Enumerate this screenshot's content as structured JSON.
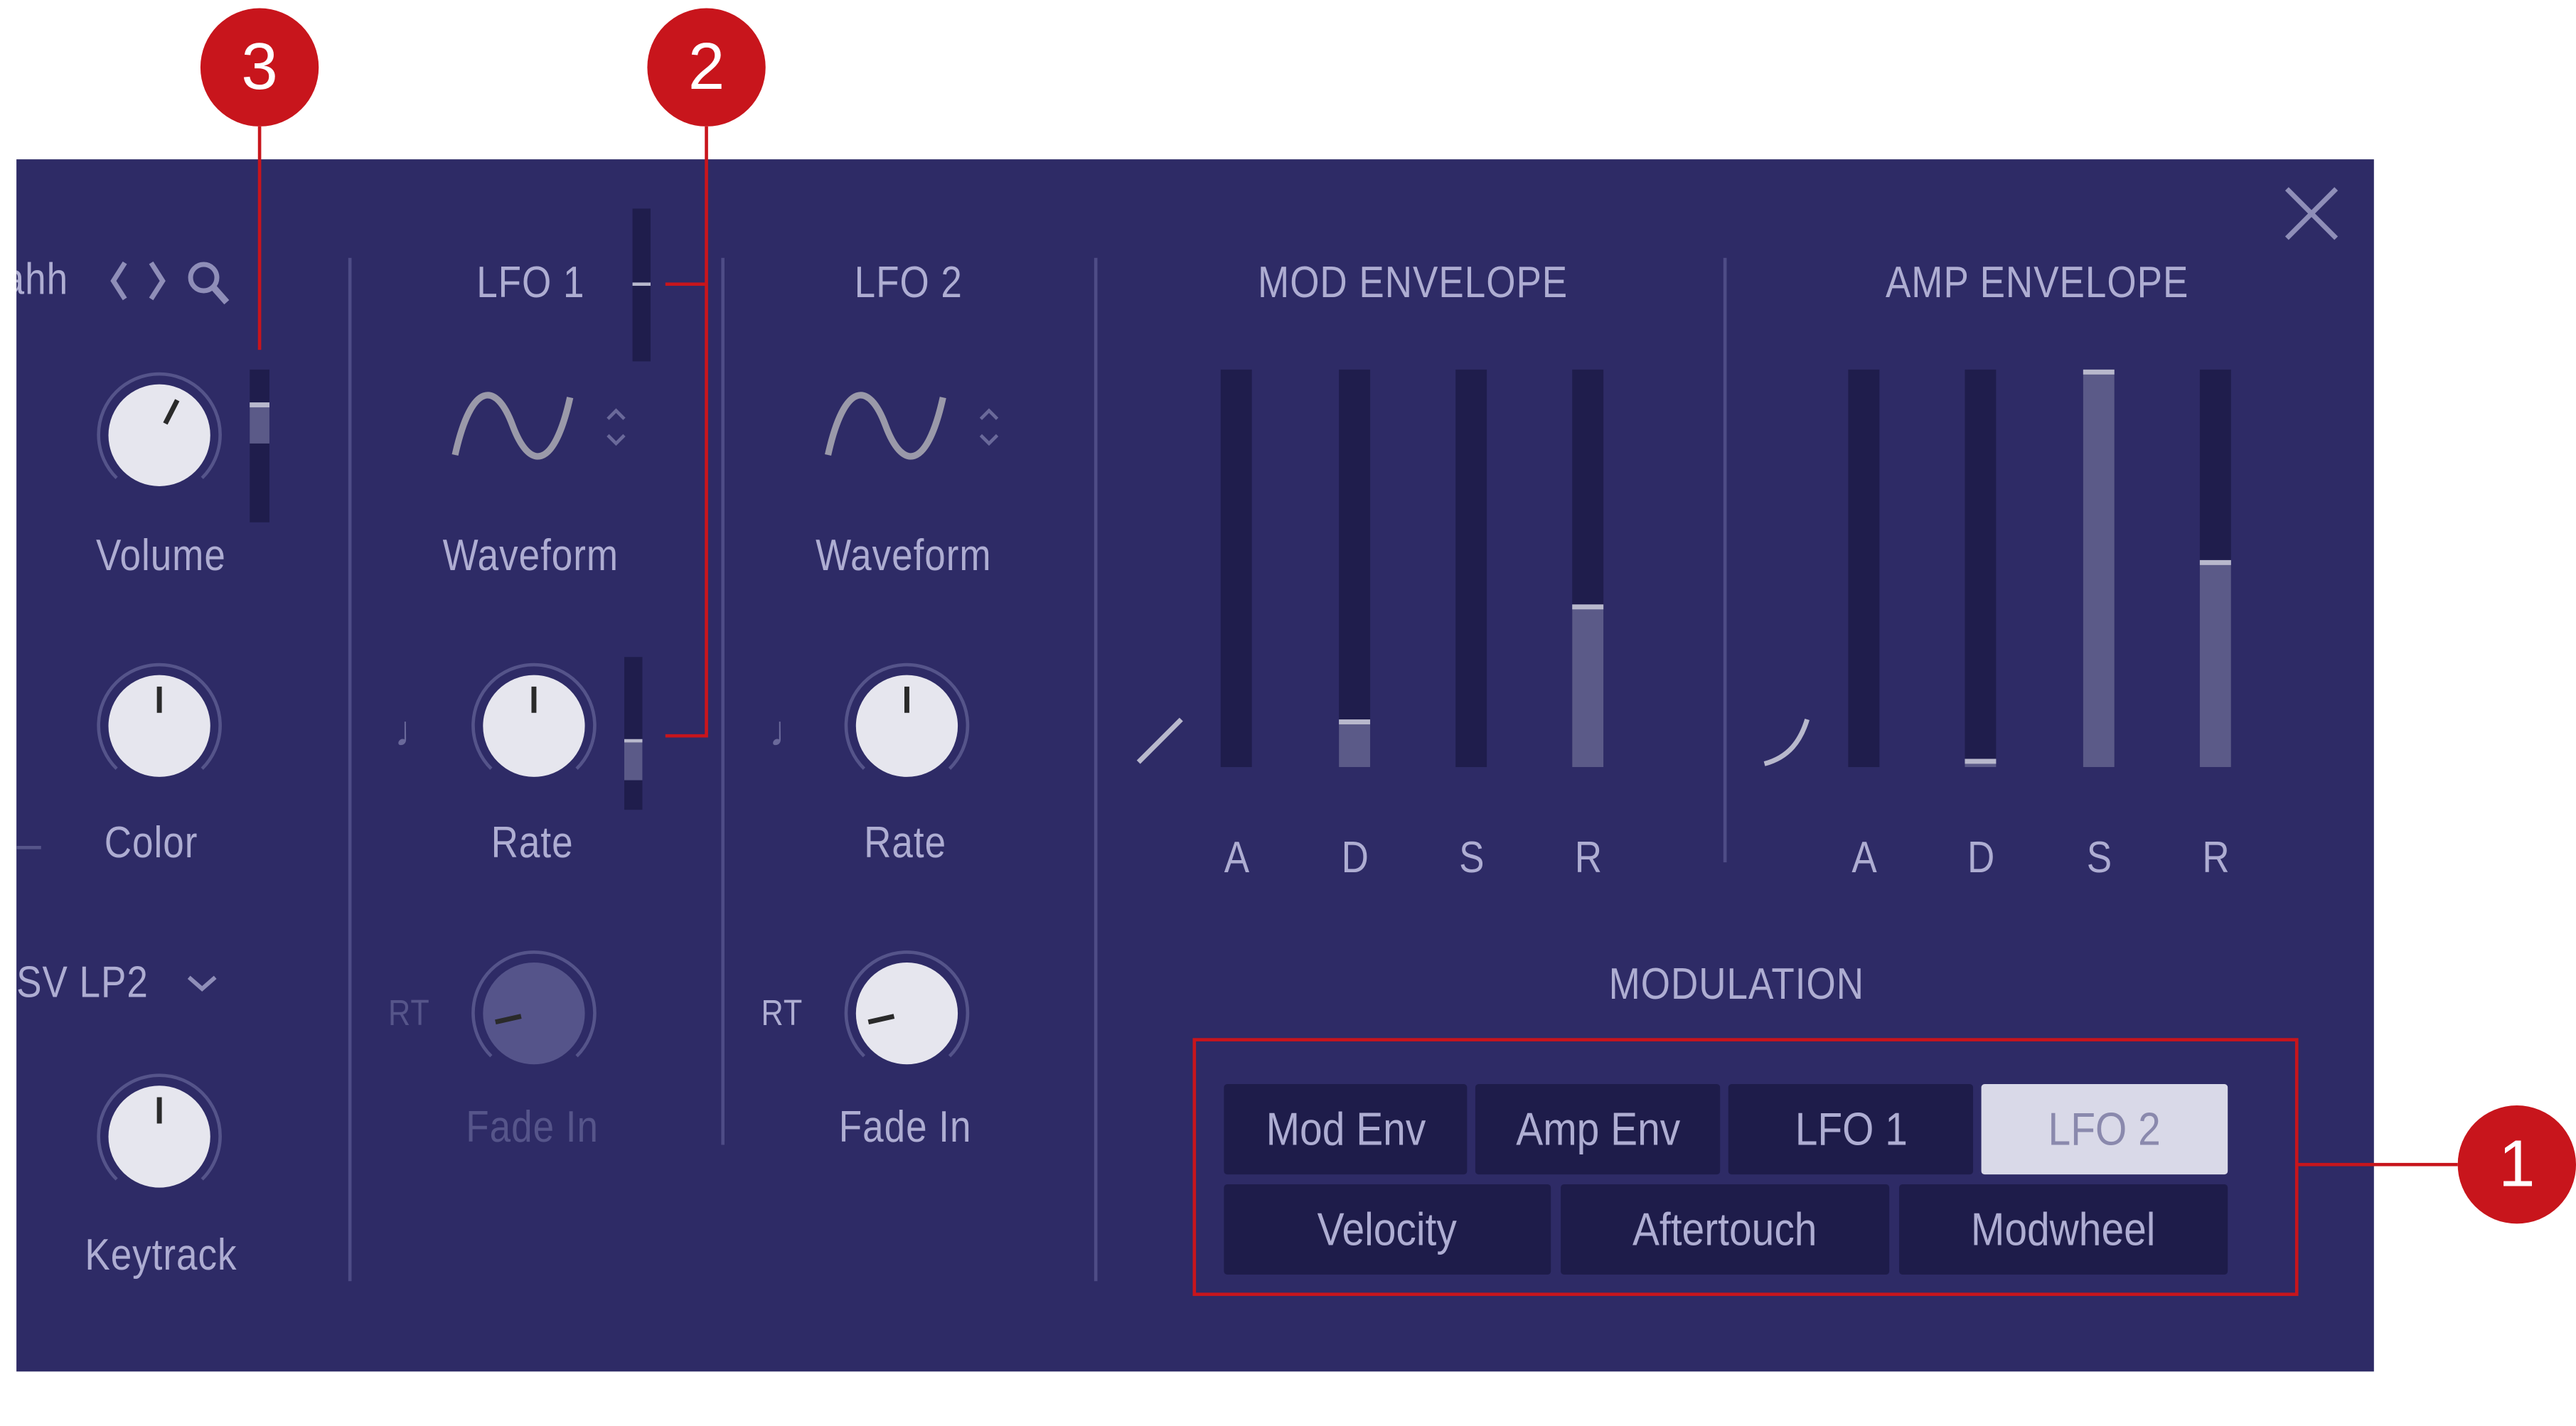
{
  "colors": {
    "panel": "#2e2b66",
    "text": "#aeadd2",
    "callout": "#c8151c",
    "slot": "#1f1d4c",
    "fill": "#5b5a88",
    "active_button": "#d9d9e8"
  },
  "callouts": [
    "1",
    "2",
    "3"
  ],
  "close_icon": "close-icon",
  "left": {
    "preset": "ahh",
    "prev_icon": "chevron-left-icon",
    "next_icon": "chevron-right-icon",
    "search_icon": "search-icon",
    "volume": {
      "label": "Volume",
      "value": 0.6,
      "mod_amount": 0.27
    },
    "color": {
      "label": "Color",
      "value": 0.5
    },
    "filter": {
      "value": "SV LP2",
      "icon": "chevron-down-icon"
    },
    "keytrack": {
      "label": "Keytrack",
      "value": 0.5
    }
  },
  "lfo1": {
    "title": "LFO 1",
    "mod_amount": 0.5,
    "waveform_label": "Waveform",
    "waveform_icon": "sine-wave-icon",
    "rate": {
      "label": "Rate",
      "value": 0.5,
      "mod_amount": 0.27
    },
    "rt_label": "RT",
    "fade_in": {
      "label": "Fade In",
      "value": 0.12,
      "enabled": false
    }
  },
  "lfo2": {
    "title": "LFO 2",
    "waveform_label": "Waveform",
    "waveform_icon": "sine-wave-icon",
    "rate": {
      "label": "Rate",
      "value": 0.5
    },
    "rt_label": "RT",
    "fade_in": {
      "label": "Fade In",
      "value": 0.12,
      "enabled": true
    }
  },
  "mod_envelope": {
    "title": "MOD ENVELOPE",
    "curve": "linear",
    "sliders": [
      {
        "label": "A",
        "value": 0
      },
      {
        "label": "D",
        "value": 0.12
      },
      {
        "label": "S",
        "value": 0
      },
      {
        "label": "R",
        "value": 0.41
      }
    ]
  },
  "amp_envelope": {
    "title": "AMP ENVELOPE",
    "curve": "exponential",
    "sliders": [
      {
        "label": "A",
        "value": 0
      },
      {
        "label": "D",
        "value": 0.02
      },
      {
        "label": "S",
        "value": 1.0
      },
      {
        "label": "R",
        "value": 0.52
      }
    ]
  },
  "modulation": {
    "title": "MODULATION",
    "buttons": [
      {
        "label": "Mod Env",
        "active": false
      },
      {
        "label": "Amp Env",
        "active": false
      },
      {
        "label": "LFO 1",
        "active": false
      },
      {
        "label": "LFO 2",
        "active": true
      },
      {
        "label": "Velocity",
        "active": false
      },
      {
        "label": "Aftertouch",
        "active": false
      },
      {
        "label": "Modwheel",
        "active": false
      }
    ]
  }
}
